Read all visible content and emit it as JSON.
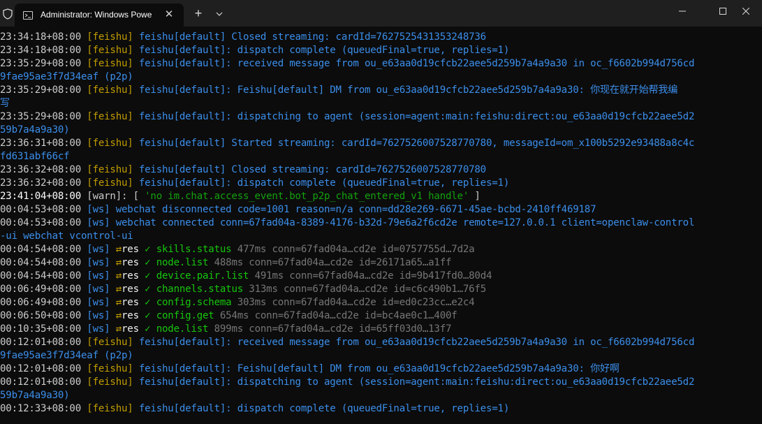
{
  "window": {
    "tab_title": "Administrator: Windows Powe",
    "tab_close_glyph": "✕",
    "new_tab_glyph": "+",
    "dropdown_glyph": "⌄"
  },
  "colors": {
    "time": "#cccccc",
    "feishu_tag": "#c19c00",
    "message": "#3b8eea",
    "warn_time": "#ffffff",
    "warn_tag": "#cccccc",
    "warn_string": "#13a10e",
    "ws_tag": "#3b8eea",
    "check": "#16c60c",
    "meta": "#767676",
    "arrows": "#c19c00",
    "res": "#f2f2f2",
    "dim_tag": "#3b8eea"
  },
  "terminal": {
    "lines": [
      {
        "segments": [
          {
            "text": "23:34:18+08:00 ",
            "color": "#cccccc"
          },
          {
            "text": "[feishu] ",
            "color": "#c19c00"
          },
          {
            "text": "feishu[default] Closed streaming: cardId=7627525431353248736",
            "color": "#3b8eea"
          }
        ]
      },
      {
        "segments": [
          {
            "text": "23:34:18+08:00 ",
            "color": "#cccccc"
          },
          {
            "text": "[feishu] ",
            "color": "#c19c00"
          },
          {
            "text": "feishu[default]: dispatch complete (queuedFinal=true, replies=1)",
            "color": "#3b8eea"
          }
        ]
      },
      {
        "segments": [
          {
            "text": "23:35:29+08:00 ",
            "color": "#cccccc"
          },
          {
            "text": "[feishu] ",
            "color": "#c19c00"
          },
          {
            "text": "feishu[default]: received message from ou_e63aa0d19cfcb22aee5d259b7a4a9a30 in oc_f6602b994d756cd",
            "color": "#3b8eea"
          }
        ]
      },
      {
        "segments": [
          {
            "text": "9fae95ae3f7d34eaf (p2p)",
            "color": "#3b8eea"
          }
        ]
      },
      {
        "segments": [
          {
            "text": "23:35:29+08:00 ",
            "color": "#cccccc"
          },
          {
            "text": "[feishu] ",
            "color": "#c19c00"
          },
          {
            "text": "feishu[default]: Feishu[default] DM from ou_e63aa0d19cfcb22aee5d259b7a4a9a30: 你现在就开始帮我编",
            "color": "#3b8eea"
          }
        ]
      },
      {
        "segments": [
          {
            "text": "写",
            "color": "#3b8eea"
          }
        ]
      },
      {
        "segments": [
          {
            "text": "23:35:29+08:00 ",
            "color": "#cccccc"
          },
          {
            "text": "[feishu] ",
            "color": "#c19c00"
          },
          {
            "text": "feishu[default]: dispatching to agent (session=agent:main:feishu:direct:ou_e63aa0d19cfcb22aee5d2",
            "color": "#3b8eea"
          }
        ]
      },
      {
        "segments": [
          {
            "text": "59b7a4a9a30)",
            "color": "#3b8eea"
          }
        ]
      },
      {
        "segments": [
          {
            "text": "23:36:31+08:00 ",
            "color": "#cccccc"
          },
          {
            "text": "[feishu] ",
            "color": "#c19c00"
          },
          {
            "text": "feishu[default] Started streaming: cardId=7627526007528770780, messageId=om_x100b5292e93488a8c4c",
            "color": "#3b8eea"
          }
        ]
      },
      {
        "segments": [
          {
            "text": "fd631abf66cf",
            "color": "#3b8eea"
          }
        ]
      },
      {
        "segments": [
          {
            "text": "23:36:32+08:00 ",
            "color": "#cccccc"
          },
          {
            "text": "[feishu] ",
            "color": "#c19c00"
          },
          {
            "text": "feishu[default] Closed streaming: cardId=7627526007528770780",
            "color": "#3b8eea"
          }
        ]
      },
      {
        "segments": [
          {
            "text": "23:36:32+08:00 ",
            "color": "#cccccc"
          },
          {
            "text": "[feishu] ",
            "color": "#c19c00"
          },
          {
            "text": "feishu[default]: dispatch complete (queuedFinal=true, replies=1)",
            "color": "#3b8eea"
          }
        ]
      },
      {
        "segments": [
          {
            "text": "23:41:04+08:00 ",
            "color": "#ffffff"
          },
          {
            "text": "[warn]: [ ",
            "color": "#cccccc"
          },
          {
            "text": "'no im.chat.access_event.bot_p2p_chat_entered_v1 handle'",
            "color": "#13a10e"
          },
          {
            "text": " ]",
            "color": "#cccccc"
          }
        ]
      },
      {
        "segments": [
          {
            "text": "00:04:53+08:00 ",
            "color": "#cccccc"
          },
          {
            "text": "[ws] webchat disconnected code=1001 reason=n/a conn=dd28e269-6671-45ae-bcbd-2410ff469187",
            "color": "#3b8eea"
          }
        ]
      },
      {
        "segments": [
          {
            "text": "00:04:53+08:00 ",
            "color": "#cccccc"
          },
          {
            "text": "[ws] webchat connected conn=67fad04a-8389-4176-b32d-79e6a2f6cd2e remote=127.0.0.1 client=openclaw-control",
            "color": "#3b8eea"
          }
        ]
      },
      {
        "segments": [
          {
            "text": "-ui webchat vcontrol-ui",
            "color": "#3b8eea"
          }
        ]
      },
      {
        "segments": [
          {
            "text": "00:04:54+08:00 ",
            "color": "#cccccc"
          },
          {
            "text": "[ws] ",
            "color": "#3b8eea"
          },
          {
            "text": "⇄",
            "color": "#c19c00"
          },
          {
            "text": "res ",
            "color": "#f2f2f2"
          },
          {
            "text": "✓ ",
            "color": "#16c60c"
          },
          {
            "text": "skills.status ",
            "color": "#16c60c"
          },
          {
            "text": "477ms conn=67fad04a…cd2e id=0757755d…7d2a",
            "color": "#767676"
          }
        ]
      },
      {
        "segments": [
          {
            "text": "00:04:54+08:00 ",
            "color": "#cccccc"
          },
          {
            "text": "[ws] ",
            "color": "#3b8eea"
          },
          {
            "text": "⇄",
            "color": "#c19c00"
          },
          {
            "text": "res ",
            "color": "#f2f2f2"
          },
          {
            "text": "✓ ",
            "color": "#16c60c"
          },
          {
            "text": "node.list ",
            "color": "#16c60c"
          },
          {
            "text": "488ms conn=67fad04a…cd2e id=26171a65…a1ff",
            "color": "#767676"
          }
        ]
      },
      {
        "segments": [
          {
            "text": "00:04:54+08:00 ",
            "color": "#cccccc"
          },
          {
            "text": "[ws] ",
            "color": "#3b8eea"
          },
          {
            "text": "⇄",
            "color": "#c19c00"
          },
          {
            "text": "res ",
            "color": "#f2f2f2"
          },
          {
            "text": "✓ ",
            "color": "#16c60c"
          },
          {
            "text": "device.pair.list ",
            "color": "#16c60c"
          },
          {
            "text": "491ms conn=67fad04a…cd2e id=9b417fd0…80d4",
            "color": "#767676"
          }
        ]
      },
      {
        "segments": [
          {
            "text": "00:06:49+08:00 ",
            "color": "#cccccc"
          },
          {
            "text": "[ws] ",
            "color": "#3b8eea"
          },
          {
            "text": "⇄",
            "color": "#c19c00"
          },
          {
            "text": "res ",
            "color": "#f2f2f2"
          },
          {
            "text": "✓ ",
            "color": "#16c60c"
          },
          {
            "text": "channels.status ",
            "color": "#16c60c"
          },
          {
            "text": "313ms conn=67fad04a…cd2e id=c6c490b1…76f5",
            "color": "#767676"
          }
        ]
      },
      {
        "segments": [
          {
            "text": "00:06:49+08:00 ",
            "color": "#cccccc"
          },
          {
            "text": "[ws] ",
            "color": "#3b8eea"
          },
          {
            "text": "⇄",
            "color": "#c19c00"
          },
          {
            "text": "res ",
            "color": "#f2f2f2"
          },
          {
            "text": "✓ ",
            "color": "#16c60c"
          },
          {
            "text": "config.schema ",
            "color": "#16c60c"
          },
          {
            "text": "303ms conn=67fad04a…cd2e id=ed0c23cc…e2c4",
            "color": "#767676"
          }
        ]
      },
      {
        "segments": [
          {
            "text": "00:06:50+08:00 ",
            "color": "#cccccc"
          },
          {
            "text": "[ws] ",
            "color": "#3b8eea"
          },
          {
            "text": "⇄",
            "color": "#c19c00"
          },
          {
            "text": "res ",
            "color": "#f2f2f2"
          },
          {
            "text": "✓ ",
            "color": "#16c60c"
          },
          {
            "text": "config.get ",
            "color": "#16c60c"
          },
          {
            "text": "654ms conn=67fad04a…cd2e id=bc4ae0c1…400f",
            "color": "#767676"
          }
        ]
      },
      {
        "segments": [
          {
            "text": "00:10:35+08:00 ",
            "color": "#cccccc"
          },
          {
            "text": "[ws] ",
            "color": "#3b8eea"
          },
          {
            "text": "⇄",
            "color": "#c19c00"
          },
          {
            "text": "res ",
            "color": "#f2f2f2"
          },
          {
            "text": "✓ ",
            "color": "#16c60c"
          },
          {
            "text": "node.list ",
            "color": "#16c60c"
          },
          {
            "text": "899ms conn=67fad04a…cd2e id=65ff03d0…13f7",
            "color": "#767676"
          }
        ]
      },
      {
        "segments": [
          {
            "text": "00:12:01+08:00 ",
            "color": "#cccccc"
          },
          {
            "text": "[feishu] ",
            "color": "#c19c00"
          },
          {
            "text": "feishu[default]: received message from ou_e63aa0d19cfcb22aee5d259b7a4a9a30 in oc_f6602b994d756cd",
            "color": "#3b8eea"
          }
        ]
      },
      {
        "segments": [
          {
            "text": "9fae95ae3f7d34eaf (p2p)",
            "color": "#3b8eea"
          }
        ]
      },
      {
        "segments": [
          {
            "text": "00:12:01+08:00 ",
            "color": "#cccccc"
          },
          {
            "text": "[feishu] ",
            "color": "#c19c00"
          },
          {
            "text": "feishu[default]: Feishu[default] DM from ou_e63aa0d19cfcb22aee5d259b7a4a9a30: 你好啊",
            "color": "#3b8eea"
          }
        ]
      },
      {
        "segments": [
          {
            "text": "00:12:01+08:00 ",
            "color": "#cccccc"
          },
          {
            "text": "[feishu] ",
            "color": "#c19c00"
          },
          {
            "text": "feishu[default]: dispatching to agent (session=agent:main:feishu:direct:ou_e63aa0d19cfcb22aee5d2",
            "color": "#3b8eea"
          }
        ]
      },
      {
        "segments": [
          {
            "text": "59b7a4a9a30)",
            "color": "#3b8eea"
          }
        ]
      },
      {
        "segments": [
          {
            "text": "00:12:33+08:00 ",
            "color": "#cccccc"
          },
          {
            "text": "[feishu] ",
            "color": "#c19c00"
          },
          {
            "text": "feishu[default]: dispatch complete (queuedFinal=true, replies=1)",
            "color": "#3b8eea"
          }
        ]
      }
    ]
  }
}
